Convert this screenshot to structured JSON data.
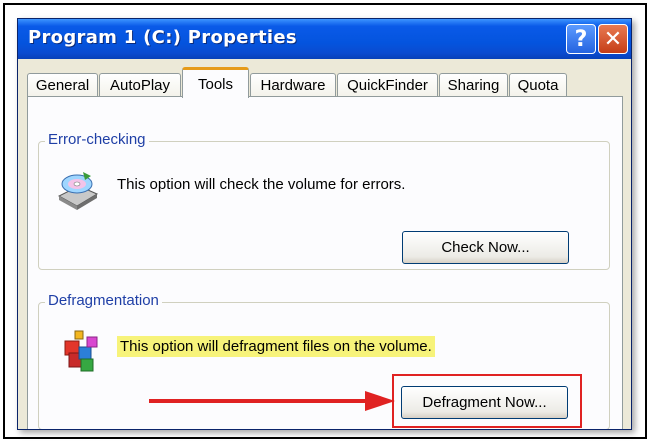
{
  "window": {
    "title": "Program 1 (C:) Properties",
    "help_label": "?",
    "close_label": "✕"
  },
  "tabs": [
    {
      "label": "General"
    },
    {
      "label": "AutoPlay"
    },
    {
      "label": "Tools",
      "active": true
    },
    {
      "label": "Hardware"
    },
    {
      "label": "QuickFinder"
    },
    {
      "label": "Sharing"
    },
    {
      "label": "Quota"
    }
  ],
  "error_checking": {
    "title": "Error-checking",
    "description": "This option will check the volume for errors.",
    "button_label": "Check Now...",
    "icon": "disk-check-icon"
  },
  "defragmentation": {
    "title": "Defragmentation",
    "description": "This option will defragment files on the volume.",
    "button_label": "Defragment Now...",
    "icon": "defrag-icon"
  },
  "colors": {
    "highlight": "#f7f37a",
    "annotation_red": "#e02222"
  }
}
